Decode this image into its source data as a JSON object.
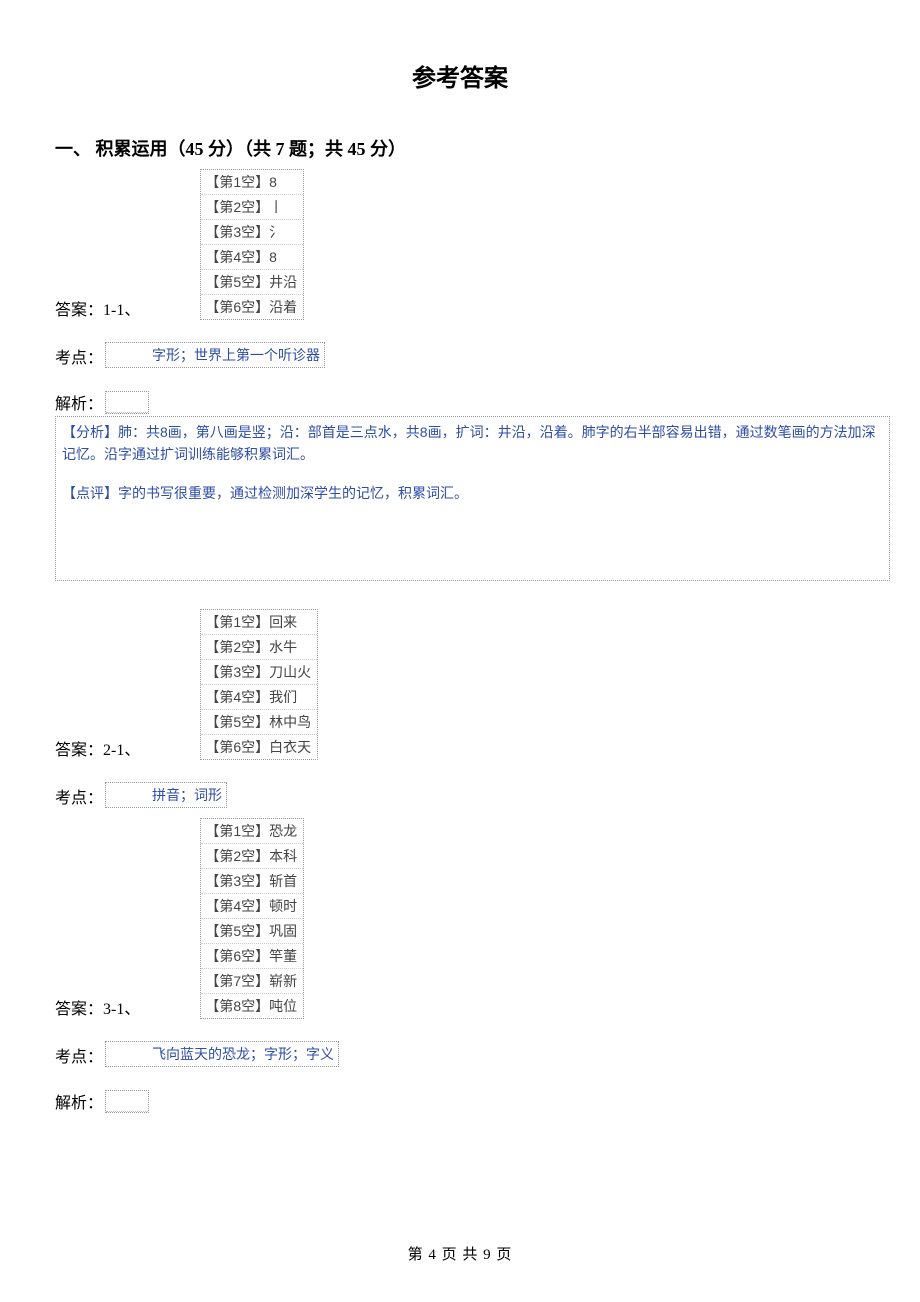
{
  "title": "参考答案",
  "section_header": "一、 积累运用（45 分）（共 7 题；共 45 分）",
  "answer_label_1": "答案：1-1、",
  "answer_label_2": "答案：2-1、",
  "answer_label_3": "答案：3-1、",
  "topic_label": "考点：",
  "explain_label": "解析：",
  "q1": {
    "rows": [
      "【第1空】8",
      "【第2空】丨",
      "【第3空】氵",
      "【第4空】8",
      "【第5空】井沿",
      "【第6空】沿着"
    ],
    "topic": "字形；世界上第一个听诊器",
    "explain_p1": "【分析】肺：共8画，第八画是竖；沿：部首是三点水，共8画，扩词：井沿，沿着。肺字的右半部容易出错，通过数笔画的方法加深记忆。沿字通过扩词训练能够积累词汇。",
    "explain_p2": "【点评】字的书写很重要，通过检测加深学生的记忆，积累词汇。"
  },
  "q2": {
    "rows": [
      "【第1空】回来",
      "【第2空】水牛",
      "【第3空】刀山火",
      "【第4空】我们",
      "【第5空】林中鸟",
      "【第6空】白衣天"
    ],
    "topic": "拼音；词形"
  },
  "q3": {
    "rows": [
      "【第1空】恐龙",
      "【第2空】本科",
      "【第3空】斩首",
      "【第4空】顿时",
      "【第5空】巩固",
      "【第6空】竿董",
      "【第7空】崭新",
      "【第8空】吨位"
    ],
    "topic": "飞向蓝天的恐龙；字形；字义"
  },
  "footer": "第 4  页 共 9  页"
}
